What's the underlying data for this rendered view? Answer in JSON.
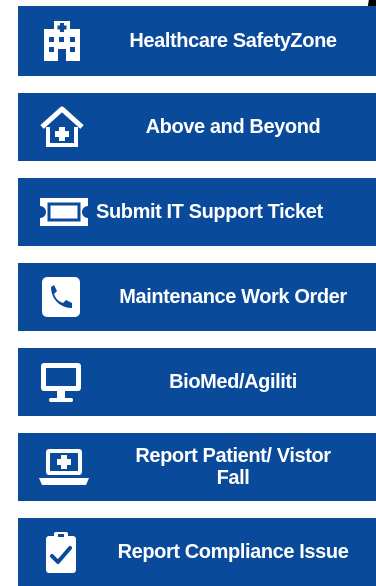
{
  "menu": {
    "items": [
      {
        "label": "Healthcare SafetyZone",
        "icon": "hospital-building-icon"
      },
      {
        "label": "Above and Beyond",
        "icon": "home-medical-icon"
      },
      {
        "label": "Submit IT Support Ticket",
        "icon": "ticket-icon"
      },
      {
        "label": "Maintenance Work Order",
        "icon": "phone-icon"
      },
      {
        "label": "BioMed/Agiliti",
        "icon": "monitor-icon"
      },
      {
        "label": "Report Patient/ Vistor\nFall",
        "icon": "laptop-medical-icon"
      },
      {
        "label": "Report Compliance Issue",
        "icon": "clipboard-check-icon"
      }
    ]
  },
  "colors": {
    "tile_bg": "#0a4a9a",
    "text": "#ffffff"
  }
}
